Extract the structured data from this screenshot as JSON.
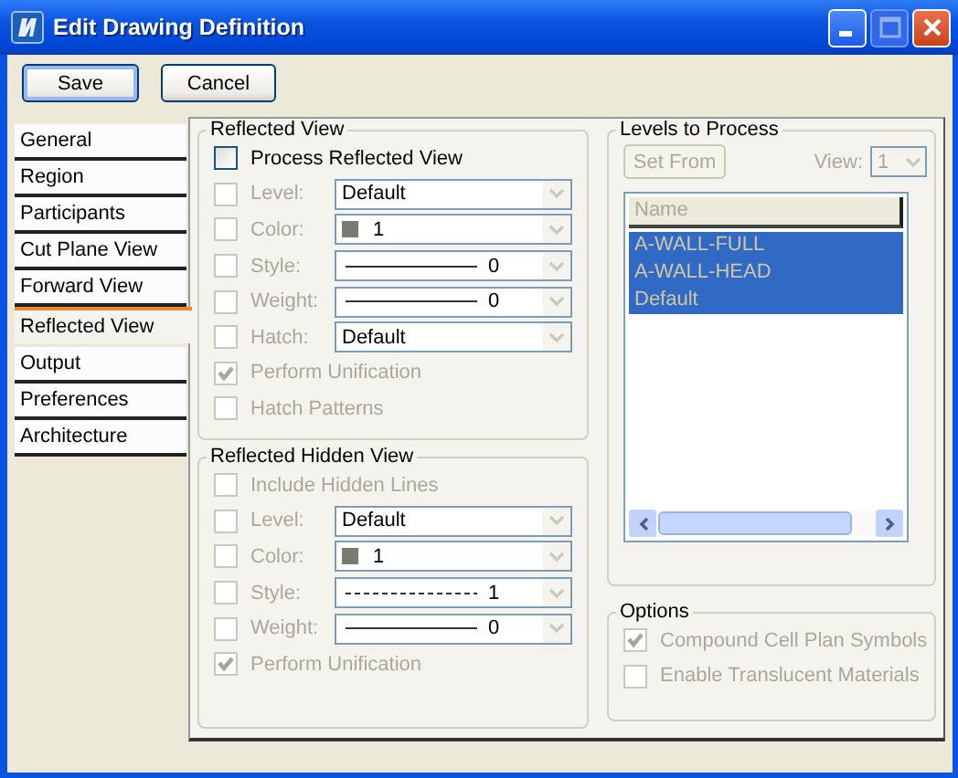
{
  "window": {
    "title": "Edit Drawing Definition"
  },
  "buttons": [
    {
      "label": "Save",
      "kind": "default"
    },
    {
      "label": "Cancel",
      "kind": "normal"
    }
  ],
  "tabs": [
    {
      "label": "General",
      "selected": false
    },
    {
      "label": "Region",
      "selected": false
    },
    {
      "label": "Participants",
      "selected": false
    },
    {
      "label": "Cut Plane View",
      "selected": false
    },
    {
      "label": "Forward View",
      "selected": false
    },
    {
      "label": "Reflected View",
      "selected": true
    },
    {
      "label": "Output",
      "selected": false
    },
    {
      "label": "Preferences",
      "selected": false
    },
    {
      "label": "Architecture",
      "selected": false
    }
  ],
  "reflected_view": {
    "title": "Reflected View",
    "rows": [
      {
        "kind": "check",
        "label": "Process Reflected View",
        "checked": false,
        "disabled": false
      },
      {
        "kind": "combo",
        "label": "Level:",
        "checked": false,
        "disabled": true,
        "field": {
          "kind": "text",
          "value": "Default"
        }
      },
      {
        "kind": "combo",
        "label": "Color:",
        "checked": false,
        "disabled": true,
        "field": {
          "kind": "color",
          "value": "1"
        }
      },
      {
        "kind": "combo",
        "label": "Style:",
        "checked": false,
        "disabled": true,
        "field": {
          "kind": "solid-line",
          "value": "0"
        }
      },
      {
        "kind": "combo",
        "label": "Weight:",
        "checked": false,
        "disabled": true,
        "field": {
          "kind": "solid-line",
          "value": "0"
        }
      },
      {
        "kind": "combo",
        "label": "Hatch:",
        "checked": false,
        "disabled": true,
        "field": {
          "kind": "text",
          "value": "Default"
        }
      },
      {
        "kind": "check",
        "label": "Perform Unification",
        "checked": true,
        "disabled": true
      },
      {
        "kind": "check",
        "label": "Hatch Patterns",
        "checked": false,
        "disabled": true
      }
    ]
  },
  "reflected_hidden_view": {
    "title": "Reflected Hidden View",
    "rows": [
      {
        "kind": "check",
        "label": "Include Hidden Lines",
        "checked": false,
        "disabled": true
      },
      {
        "kind": "combo",
        "label": "Level:",
        "checked": false,
        "disabled": true,
        "field": {
          "kind": "text",
          "value": "Default"
        }
      },
      {
        "kind": "combo",
        "label": "Color:",
        "checked": false,
        "disabled": true,
        "field": {
          "kind": "color",
          "value": "1"
        }
      },
      {
        "kind": "combo",
        "label": "Style:",
        "checked": false,
        "disabled": true,
        "field": {
          "kind": "dashed-line",
          "value": "1"
        }
      },
      {
        "kind": "combo",
        "label": "Weight:",
        "checked": false,
        "disabled": true,
        "field": {
          "kind": "solid-line",
          "value": "0"
        }
      },
      {
        "kind": "check",
        "label": "Perform Unification",
        "checked": true,
        "disabled": true
      }
    ]
  },
  "levels_to_process": {
    "title": "Levels to Process",
    "set_from": {
      "label": "Set From",
      "disabled": true
    },
    "view": {
      "label": "View:",
      "value": "1",
      "disabled": true
    },
    "list": {
      "column": "Name",
      "rows": [
        {
          "label": "A-WALL-FULL",
          "selected": true
        },
        {
          "label": "A-WALL-HEAD",
          "selected": true
        },
        {
          "label": "Default",
          "selected": true
        }
      ]
    }
  },
  "options": {
    "title": "Options",
    "rows": [
      {
        "kind": "check",
        "label": "Compound Cell Plan Symbols",
        "checked": true,
        "disabled": true
      },
      {
        "kind": "check",
        "label": "Enable Translucent Materials",
        "checked": false,
        "disabled": true
      }
    ]
  }
}
